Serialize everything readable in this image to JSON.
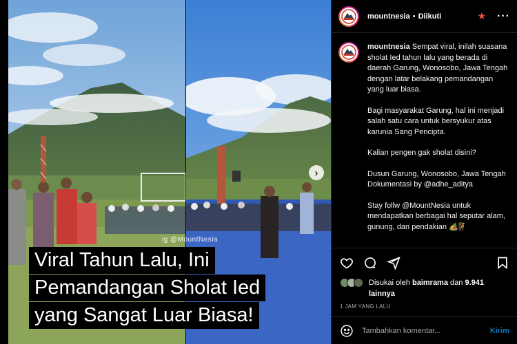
{
  "photo": {
    "watermark": "ig @MountNesia",
    "caption_lines": [
      "Viral Tahun Lalu, Ini",
      "Pemandangan Sholat Ied",
      "yang Sangat Luar Biasa!"
    ]
  },
  "header": {
    "username": "mountnesia",
    "separator": "•",
    "follow_status": "Diikuti",
    "star_icon": "star-icon",
    "more_icon": "more-options-icon"
  },
  "post": {
    "username": "mountnesia",
    "paragraphs": [
      "Sempat viral, inilah suasana sholat Ied tahun lalu yang berada di daerah Garung, Wonosobo, Jawa Tengah dengan latar belakang pemandangan yang luar biasa.",
      "Bagi masyarakat Garung, hal ini menjadi salah satu cara untuk bersyukur atas karunia Sang Pencipta.",
      "Kalian pengen gak sholat disini?",
      "Dusun Garung, Wonosobo, Jawa Tengah\nDokumentasi by @adhe_aditya",
      "Stay follw @MountNesia untuk mendapatkan berbagai hal seputar alam, gunung, dan pendakian 🏕️🧗"
    ]
  },
  "likes": {
    "prefix": "Disukai oleh",
    "user": "baimrama",
    "middle": "dan",
    "count": "9.941",
    "suffix": "lainnya"
  },
  "timestamp": "1 JAM YANG LALU",
  "comment_box": {
    "placeholder": "Tambahkan komentar...",
    "post_label": "Kirim"
  },
  "colors": {
    "accent_blue": "#0095f6",
    "star": "#e8503a",
    "background": "#000000"
  }
}
